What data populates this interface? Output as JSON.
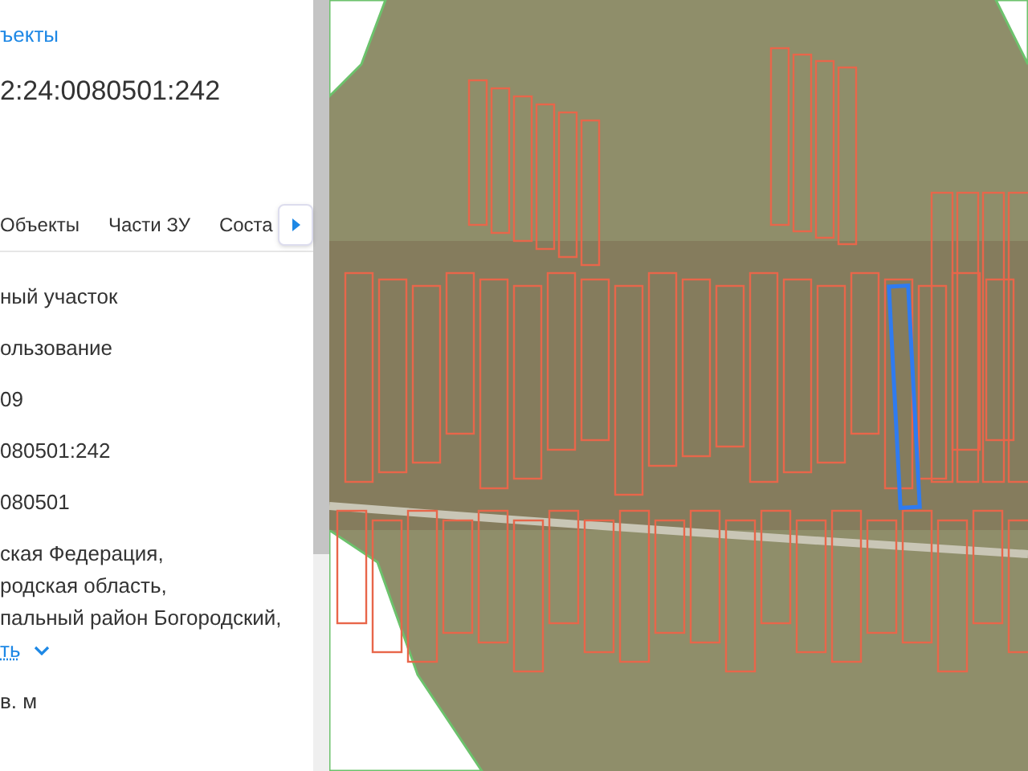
{
  "panel": {
    "back_link": "ъекты",
    "title": "2:24:0080501:242",
    "tabs": [
      {
        "label": "Объекты"
      },
      {
        "label": "Части ЗУ"
      },
      {
        "label": "Соста"
      }
    ],
    "rows": [
      {
        "kind": "text",
        "value": "ный участок"
      },
      {
        "kind": "text",
        "value": "ользование"
      },
      {
        "kind": "text",
        "value": "09"
      },
      {
        "kind": "text",
        "value": "080501:242"
      },
      {
        "kind": "text",
        "value": "080501"
      },
      {
        "kind": "address",
        "lines": [
          "ская Федерация,",
          "родская область,",
          "пальный район Богородский,"
        ],
        "more": "ть"
      },
      {
        "kind": "text",
        "value": "в. м"
      }
    ]
  }
}
